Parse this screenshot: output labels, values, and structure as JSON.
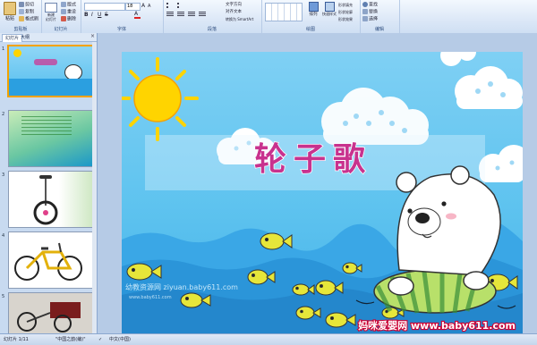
{
  "ribbon": {
    "clipboard": {
      "paste": "粘贴",
      "cut": "剪切",
      "copy": "复制",
      "format_painter": "格式刷",
      "label": "剪贴板"
    },
    "slides": {
      "new_slide": "新建\n幻灯片",
      "layout": "版式",
      "reset": "重设",
      "delete": "删除",
      "label": "幻灯片"
    },
    "font": {
      "size": "18",
      "label": "字体"
    },
    "paragraph": {
      "text_direction": "文字方向",
      "align_text": "对齐文本",
      "smartart": "转换为 SmartArt",
      "label": "段落"
    },
    "drawing": {
      "arrange": "排列",
      "quick_styles": "快速样式",
      "shape_fill": "形状填充",
      "shape_outline": "形状轮廓",
      "shape_effects": "形状效果",
      "label": "绘图"
    },
    "editing": {
      "find": "查找",
      "replace": "替换",
      "select": "选择",
      "label": "编辑"
    }
  },
  "leftpane": {
    "tab_slides": "幻灯片",
    "tab_outline": "大纲",
    "close": "×",
    "slide_numbers": [
      "1",
      "2",
      "3",
      "4",
      "5"
    ]
  },
  "slide": {
    "title": "轮子歌",
    "watermark": "幼教资源网 ziyuan.baby611.com",
    "watermark_sub": "www.baby611.com",
    "site_logo": "妈咪爱婴网 www.baby611.com"
  },
  "status": {
    "slide_count": "幻灯片 1/11",
    "theme": "\"中国之韵(编)\"",
    "language": "中文(中国)"
  },
  "colors": {
    "selected_border": "#f3a200",
    "ribbon_text": "#2a4a7c",
    "sun": "#ffd400"
  }
}
